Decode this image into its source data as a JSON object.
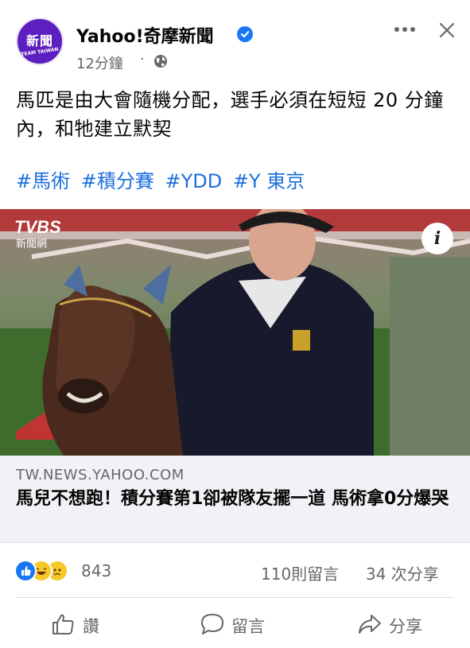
{
  "post": {
    "page_name": "Yahoo!奇摩新聞",
    "avatar_text": "新聞",
    "avatar_sub": "TEAM TAIWAN",
    "time": "12分鐘",
    "separator": "·",
    "text": "馬匹是由大會隨機分配，選手必須在短短 20 分鐘內，和牠建立默契",
    "hashtags": [
      "#馬術",
      "#積分賽",
      "#YDD",
      "#Y 東京"
    ]
  },
  "image": {
    "watermark_main": "TVBS",
    "watermark_sub": "新聞網",
    "info_label": "i"
  },
  "link": {
    "domain": "TW.NEWS.YAHOO.COM",
    "title": "馬兒不想跑！積分賽第1卻被隊友擺一道 馬術拿0分爆哭"
  },
  "stats": {
    "reaction_count": "843",
    "comments": "110則留言",
    "shares": "34 次分享",
    "reaction_icons": [
      "like-icon",
      "haha-icon",
      "sad-icon"
    ]
  },
  "actions": {
    "like": "讚",
    "comment": "留言",
    "share": "分享"
  },
  "colors": {
    "accent": "#1877f2",
    "hashtag": "#1d6fde",
    "secondary_text": "#65676b",
    "link_box_bg": "#f0f2f5"
  }
}
